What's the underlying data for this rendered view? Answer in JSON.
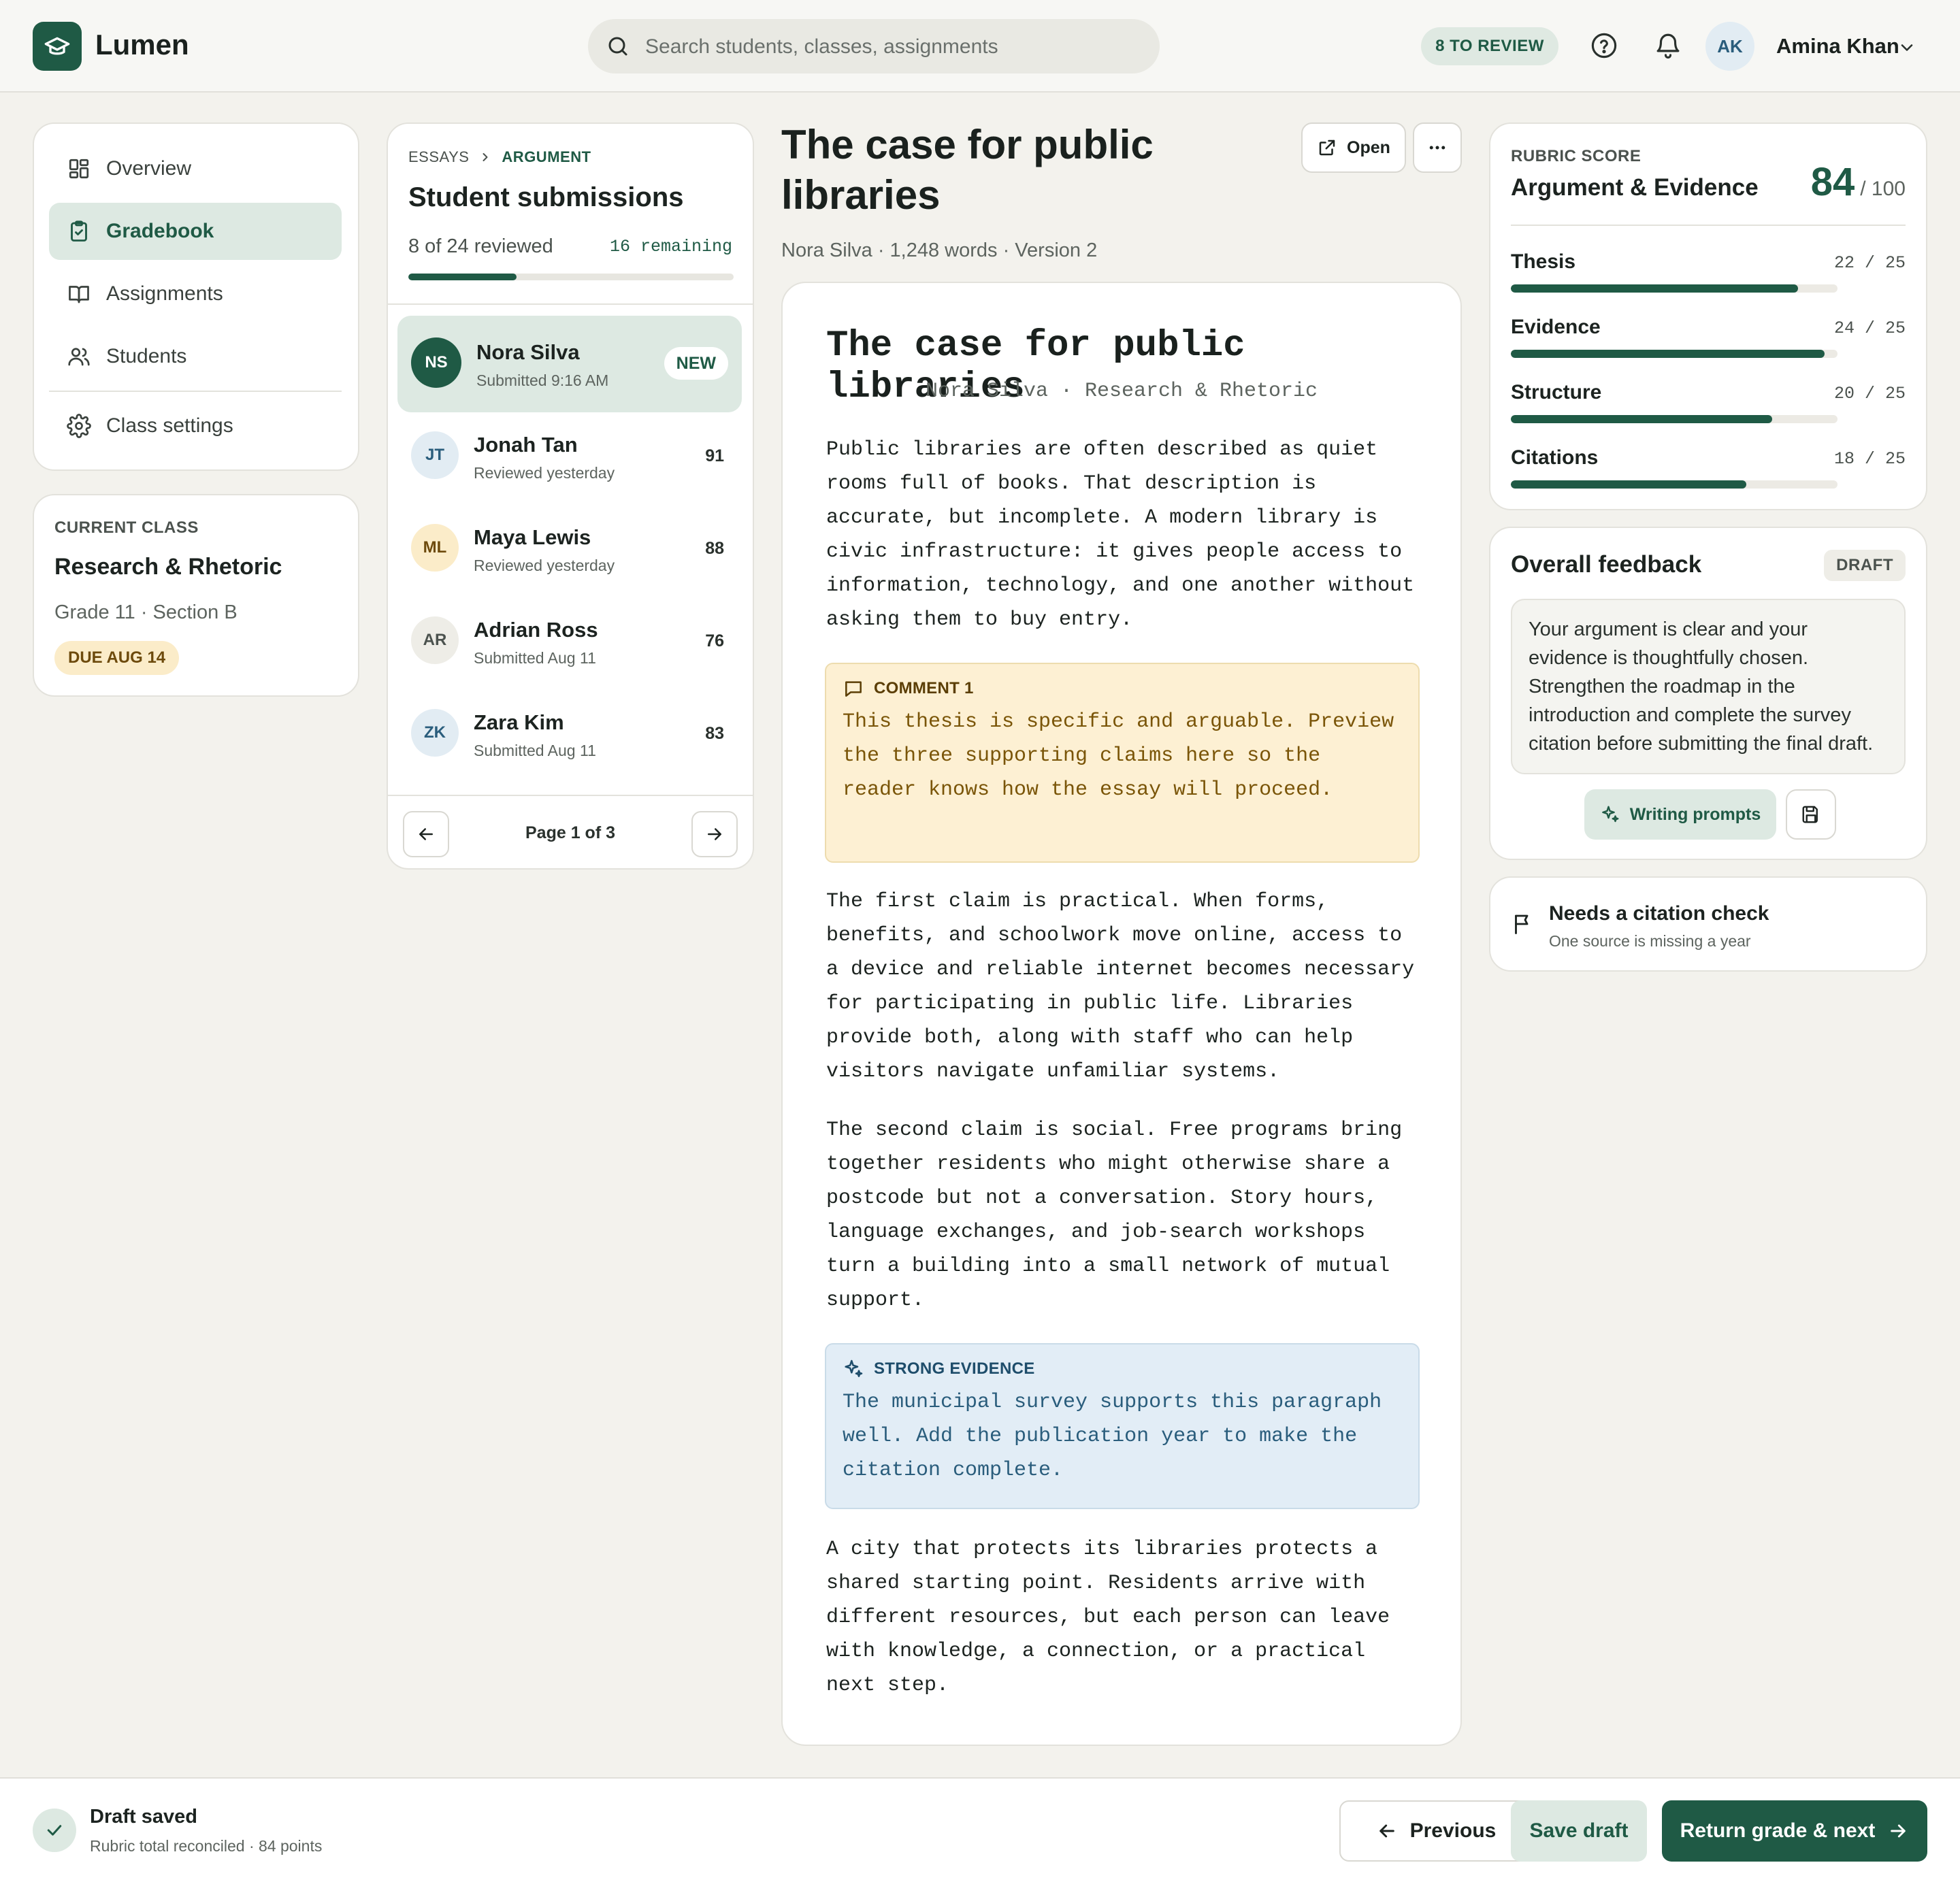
{
  "colors": {
    "brand": "#1f5a45",
    "brand_soft": "#dde9e2",
    "warning_soft": "#fdf0d3",
    "info_soft": "#e2edf6"
  },
  "app": {
    "name": "Lumen",
    "logo_icon": "graduation-cap-icon"
  },
  "search": {
    "placeholder": "Search students, classes, assignments"
  },
  "header": {
    "review_badge": "8 TO REVIEW",
    "user_initials": "AK",
    "user_name": "Amina Khan"
  },
  "nav": {
    "items": [
      {
        "label": "Overview",
        "icon": "dashboard-icon"
      },
      {
        "label": "Gradebook",
        "icon": "clipboard-check-icon",
        "active": true
      },
      {
        "label": "Assignments",
        "icon": "book-icon"
      },
      {
        "label": "Students",
        "icon": "users-icon"
      },
      {
        "label": "Class settings",
        "icon": "gear-icon"
      }
    ]
  },
  "current_class": {
    "kicker": "CURRENT CLASS",
    "name": "Research & Rhetoric",
    "section": "Grade 11 · Section B",
    "due": "DUE AUG 14"
  },
  "submissions": {
    "breadcrumb": [
      "ESSAYS",
      "ARGUMENT"
    ],
    "title": "Student submissions",
    "reviewed_text": "8 of 24 reviewed",
    "remaining_text": "16 remaining",
    "progress": 0.333,
    "rows": [
      {
        "initials": "NS",
        "name": "Nora Silva",
        "meta": "Submitted 9:16 AM",
        "badge": "NEW",
        "score": ""
      },
      {
        "initials": "JT",
        "name": "Jonah Tan",
        "meta": "Reviewed yesterday",
        "badge": "",
        "score": "91"
      },
      {
        "initials": "ML",
        "name": "Maya Lewis",
        "meta": "Reviewed yesterday",
        "badge": "",
        "score": "88"
      },
      {
        "initials": "AR",
        "name": "Adrian Ross",
        "meta": "Submitted Aug 11",
        "badge": "",
        "score": "76"
      },
      {
        "initials": "ZK",
        "name": "Zara Kim",
        "meta": "Submitted Aug 11",
        "badge": "",
        "score": "83"
      }
    ],
    "pagination": "Page 1 of 3"
  },
  "document": {
    "heading": "The case for public libraries",
    "meta": "Nora Silva · 1,248 words · Version 2",
    "open_label": "Open",
    "essay_title": "The case for public libraries",
    "essay_byline": "Nora Silva · Research & Rhetoric",
    "p1": "Public libraries are often described as quiet rooms full of books. That description is accurate, but incomplete. A modern library is civic infrastructure: it gives people access to information, technology, and one another without asking them to buy entry.",
    "comment1_label": "COMMENT 1",
    "comment1_body": "This thesis is specific and arguable. Preview the three supporting claims here so the reader knows how the essay will proceed.",
    "p2": "The first claim is practical. When forms, benefits, and schoolwork move online, access to a device and reliable internet becomes necessary for participating in public life. Libraries provide both, along with staff who can help visitors navigate unfamiliar systems.",
    "p3": "The second claim is social. Free programs bring together residents who might otherwise share a postcode but not a conversation. Story hours, language exchanges, and job-search workshops turn a building into a small network of mutual support.",
    "evidence_label": "STRONG EVIDENCE",
    "evidence_body": "The municipal survey supports this paragraph well. Add the publication year to make the citation complete.",
    "p4": "A city that protects its libraries protects a shared starting point. Residents arrive with different resources, but each person can leave with knowledge, a connection, or a practical next step."
  },
  "rubric": {
    "kicker": "RUBRIC SCORE",
    "title": "Argument & Evidence",
    "score": "84",
    "out_of": "/ 100",
    "criteria": [
      {
        "name": "Thesis",
        "score": 22,
        "max": 25,
        "display": "22 / 25"
      },
      {
        "name": "Evidence",
        "score": 24,
        "max": 25,
        "display": "24 / 25"
      },
      {
        "name": "Structure",
        "score": 20,
        "max": 25,
        "display": "20 / 25"
      },
      {
        "name": "Citations",
        "score": 18,
        "max": 25,
        "display": "18 / 25"
      }
    ]
  },
  "feedback": {
    "title": "Overall feedback",
    "status": "DRAFT",
    "text": "Your argument is clear and your evidence is thoughtfully chosen. Strengthen the roadmap in the introduction and complete the survey citation before submitting the final draft.",
    "prompts_label": "Writing prompts"
  },
  "flag": {
    "title": "Needs a citation check",
    "subtitle": "One source is missing a year"
  },
  "footer": {
    "status_title": "Draft saved",
    "status_sub": "Rubric total reconciled · 84 points",
    "previous": "Previous",
    "save": "Save draft",
    "next": "Return grade & next"
  }
}
